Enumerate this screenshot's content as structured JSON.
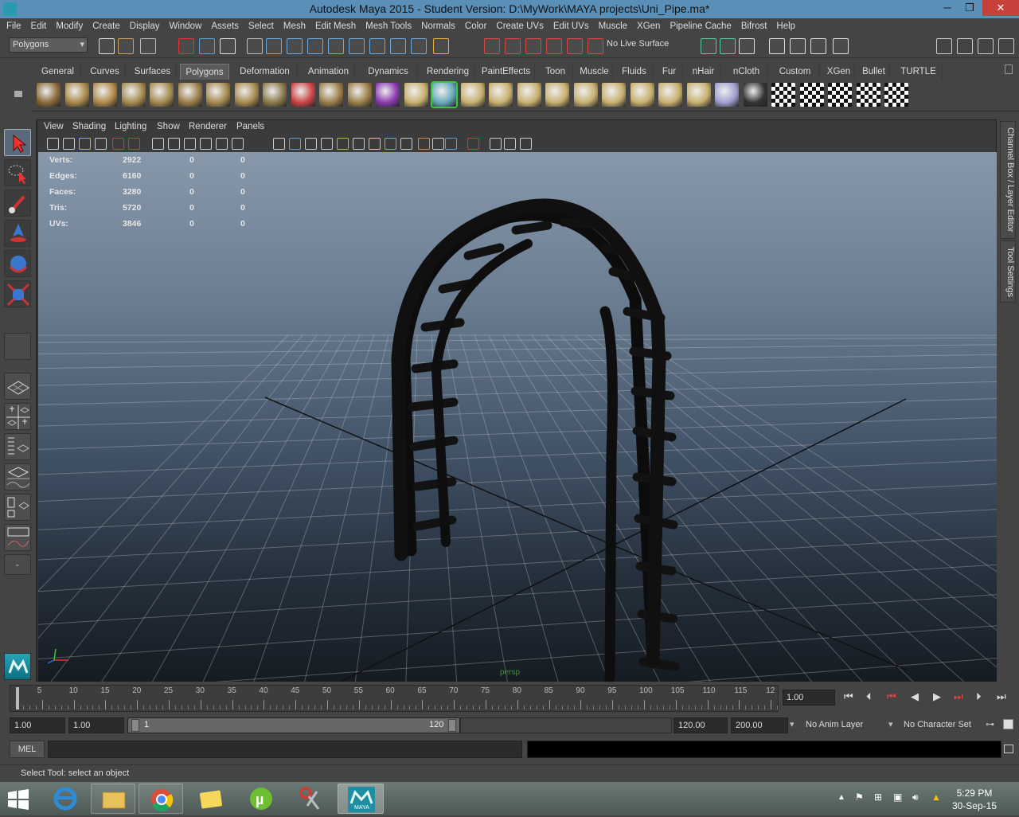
{
  "window": {
    "title": "Autodesk Maya 2015 - Student Version: D:\\MyWork\\MAYA projects\\Uni_Pipe.ma*",
    "minimize_glyph": "─",
    "restore_glyph": "❐",
    "close_glyph": "✕"
  },
  "menubar": {
    "items": [
      "File",
      "Edit",
      "Modify",
      "Create",
      "Display",
      "Window",
      "Assets",
      "Select",
      "Mesh",
      "Edit Mesh",
      "Mesh Tools",
      "Normals",
      "Color",
      "Create UVs",
      "Edit UVs",
      "Muscle",
      "XGen",
      "Pipeline Cache",
      "Bifrost",
      "Help"
    ]
  },
  "statusline": {
    "mode": "Polygons",
    "live_surface": "No Live Surface"
  },
  "shelf": {
    "tabs": [
      "General",
      "Curves",
      "Surfaces",
      "Polygons",
      "Deformation",
      "Animation",
      "Dynamics",
      "Rendering",
      "PaintEffects",
      "Toon",
      "Muscle",
      "Fluids",
      "Fur",
      "nHair",
      "nCloth",
      "Custom",
      "XGen",
      "Bullet",
      "TURTLE"
    ],
    "active_tab": "Polygons"
  },
  "viewport": {
    "menu": [
      "View",
      "Shading",
      "Lighting",
      "Show",
      "Renderer",
      "Panels"
    ],
    "camera": "persp",
    "hud": [
      {
        "label": "Verts:",
        "v1": "2922",
        "v2": "0",
        "v3": "0"
      },
      {
        "label": "Edges:",
        "v1": "6160",
        "v2": "0",
        "v3": "0"
      },
      {
        "label": "Faces:",
        "v1": "3280",
        "v2": "0",
        "v3": "0"
      },
      {
        "label": "Tris:",
        "v1": "5720",
        "v2": "0",
        "v3": "0"
      },
      {
        "label": "UVs:",
        "v1": "3846",
        "v2": "0",
        "v3": "0"
      }
    ]
  },
  "right_panel": {
    "tab1": "Channel Box / Layer Editor",
    "tab2": "Tool Settings"
  },
  "timeline": {
    "ticks": [
      "1",
      "5",
      "10",
      "15",
      "20",
      "25",
      "30",
      "35",
      "40",
      "45",
      "50",
      "55",
      "60",
      "65",
      "70",
      "75",
      "80",
      "85",
      "90",
      "95",
      "100",
      "105",
      "110",
      "115",
      "12"
    ],
    "current_frame": "1.00"
  },
  "range": {
    "start": "1.00",
    "start2": "1.00",
    "slider_start": "1",
    "slider_end": "120",
    "end": "120.00",
    "end2": "200.00",
    "anim_layer": "No Anim Layer",
    "character_set": "No Character Set"
  },
  "commandline": {
    "label": "MEL"
  },
  "helpline": {
    "text": "Select Tool: select an object"
  },
  "taskbar": {
    "time": "5:29 PM",
    "date": "30-Sep-15",
    "maya_label": "MAYA"
  }
}
